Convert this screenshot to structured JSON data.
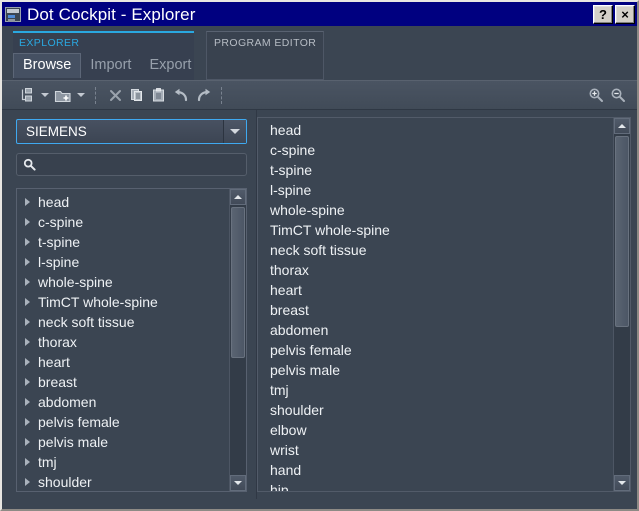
{
  "window": {
    "title": "Dot Cockpit - Explorer",
    "icon": "application-icon",
    "help_label": "?",
    "close_label": "×",
    "titlebar_color": "#000080",
    "accent_color": "#2aa8e0",
    "background_color": "#3b4552"
  },
  "panels": {
    "explorer": {
      "label": "EXPLORER",
      "active": true,
      "tabs": [
        {
          "label": "Browse",
          "selected": true
        },
        {
          "label": "Import",
          "selected": false
        },
        {
          "label": "Export",
          "selected": false
        }
      ]
    },
    "program_editor": {
      "label": "PROGRAM EDITOR",
      "active": false
    }
  },
  "toolbar": {
    "buttons": [
      {
        "name": "new-item-icon",
        "label": "New"
      },
      {
        "name": "new-item-dropdown-caret",
        "label": ""
      },
      {
        "name": "new-folder-icon",
        "label": "New folder"
      },
      {
        "name": "new-folder-dropdown-caret",
        "label": ""
      },
      {
        "name": "delete-icon",
        "label": "Delete"
      },
      {
        "name": "copy-icon",
        "label": "Copy"
      },
      {
        "name": "paste-icon",
        "label": "Paste"
      },
      {
        "name": "undo-icon",
        "label": "Undo"
      },
      {
        "name": "redo-icon",
        "label": "Redo"
      }
    ],
    "right_buttons": [
      {
        "name": "zoom-in-icon",
        "label": "Zoom in"
      },
      {
        "name": "zoom-out-icon",
        "label": "Zoom out"
      }
    ]
  },
  "left_pane": {
    "vendor_select": {
      "value": "SIEMENS",
      "focused": true
    },
    "search": {
      "value": "",
      "placeholder": ""
    },
    "tree_items": [
      "head",
      "c-spine",
      "t-spine",
      "l-spine",
      "whole-spine",
      "TimCT whole-spine",
      "neck soft tissue",
      "thorax",
      "heart",
      "breast",
      "abdomen",
      "pelvis female",
      "pelvis male",
      "tmj",
      "shoulder"
    ],
    "scrollbar": {
      "thumb_top_pct": 0,
      "thumb_height_pct": 56
    }
  },
  "right_pane": {
    "list_items": [
      "head",
      "c-spine",
      "t-spine",
      "l-spine",
      "whole-spine",
      "TimCT whole-spine",
      "neck soft tissue",
      "thorax",
      "heart",
      "breast",
      "abdomen",
      "pelvis female",
      "pelvis male",
      "tmj",
      "shoulder",
      "elbow",
      "wrist",
      "hand",
      "hip"
    ],
    "scrollbar": {
      "thumb_top_pct": 0,
      "thumb_height_pct": 56
    }
  }
}
